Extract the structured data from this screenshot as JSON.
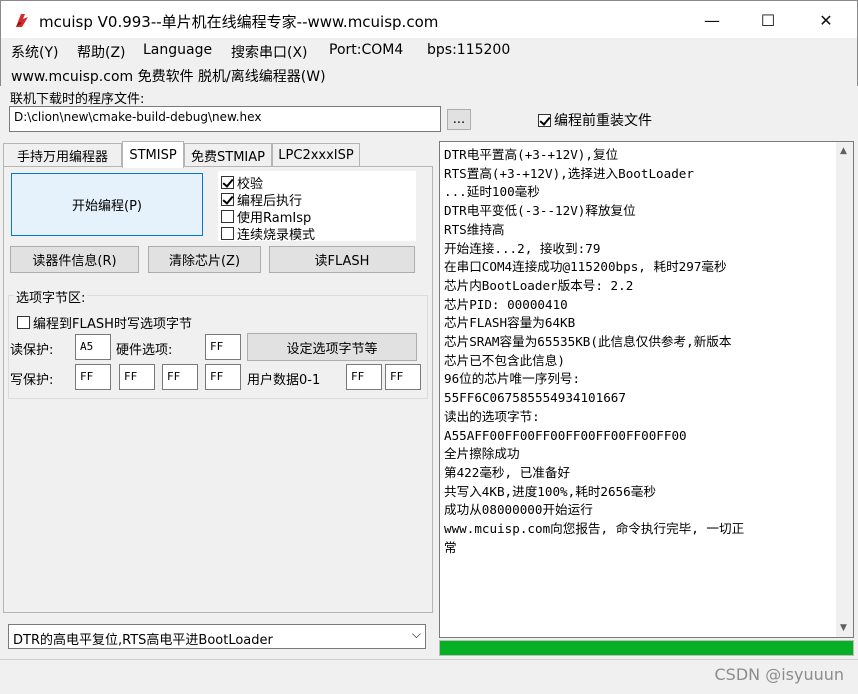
{
  "window": {
    "title": "mcuisp V0.993--单片机在线编程专家--www.mcuisp.com",
    "minimize": "—",
    "maximize": "☐",
    "close": "✕"
  },
  "menu": {
    "items": [
      "系统(Y)",
      "帮助(Z)",
      "Language",
      "搜索串口(X)",
      "Port:COM4",
      "bps:115200"
    ],
    "second_row": "www.mcuisp.com 免费软件 脱机/离线编程器(W)"
  },
  "file": {
    "label": "联机下载时的程序文件:",
    "path": "D:\\clion\\new\\cmake-build-debug\\new.hex",
    "browse_label": "...",
    "reload_label": "编程前重装文件",
    "reload_checked": true
  },
  "tabs": [
    {
      "label": "手持万用编程器"
    },
    {
      "label": "STMISP"
    },
    {
      "label": "免费STMIAP"
    },
    {
      "label": "LPC2xxxISP"
    }
  ],
  "stmisp": {
    "start_button": "开始编程(P)",
    "options": [
      {
        "label": "校验",
        "checked": true
      },
      {
        "label": "编程后执行",
        "checked": true
      },
      {
        "label": "使用RamIsp",
        "checked": false
      },
      {
        "label": "连续烧录模式",
        "checked": false
      }
    ],
    "read_info_button": "读器件信息(R)",
    "erase_button": "清除芯片(Z)",
    "read_flash_button": "读FLASH",
    "option_bytes": {
      "group_label": "选项字节区:",
      "write_on_flash_label": "编程到FLASH时写选项字节",
      "read_protect_label": "读保护:",
      "read_protect_value": "A5",
      "hardware_label": "硬件选项:",
      "hardware_value": "FF",
      "set_button": "设定选项字节等",
      "write_protect_label": "写保护:",
      "write_protect_values": [
        "FF",
        "FF",
        "FF",
        "FF"
      ],
      "user_data_label": "用户数据0-1",
      "user_data_values": [
        "FF",
        "FF"
      ]
    }
  },
  "reset_mode": "DTR的高电平复位,RTS高电平进BootLoader",
  "log": [
    "DTR电平置高(+3-+12V),复位",
    "RTS置高(+3-+12V),选择进入BootLoader",
    "...延时100毫秒",
    "DTR电平变低(-3--12V)释放复位",
    "RTS维持高",
    "开始连接...2, 接收到:79",
    "在串口COM4连接成功@115200bps, 耗时297毫秒",
    "芯片内BootLoader版本号: 2.2",
    "芯片PID: 00000410",
    "芯片FLASH容量为64KB",
    "芯片SRAM容量为65535KB(此信息仅供参考,新版本",
    "芯片已不包含此信息)",
    "96位的芯片唯一序列号:",
    "55FF6C067585554934101667",
    "读出的选项字节:",
    "A55AFF00FF00FF00FF00FF00FF00FF00",
    "全片擦除成功",
    "第422毫秒, 已准备好",
    "共写入4KB,进度100%,耗时2656毫秒",
    "成功从08000000开始运行",
    "www.mcuisp.com向您报告, 命令执行完毕, 一切正",
    "常"
  ],
  "progress": 1.0,
  "watermark": "CSDN @isyuuun",
  "colors": {
    "progress": "#06b025",
    "app_icon": "#d42a2a"
  }
}
